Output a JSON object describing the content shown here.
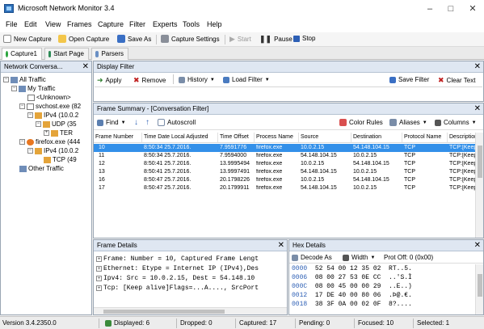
{
  "window": {
    "title": "Microsoft Network Monitor 3.4"
  },
  "menu": [
    "File",
    "Edit",
    "View",
    "Frames",
    "Capture",
    "Filter",
    "Experts",
    "Tools",
    "Help"
  ],
  "toolbar": {
    "new_capture": "New Capture",
    "open_capture": "Open Capture",
    "save_as": "Save As",
    "capture_settings": "Capture Settings",
    "start": "Start",
    "pause": "Pause",
    "stop": "Stop"
  },
  "tabs": [
    "Capture1",
    "Start Page",
    "Parsers"
  ],
  "conversations": {
    "header": "Network Conversa...",
    "items": [
      "All Traffic",
      "My Traffic",
      "<Unknown>",
      "svchost.exe (82",
      "IPv4 (10.0.2",
      "UDP (35",
      "TER",
      "firefox.exe (444",
      "IPv4 (10.0.2",
      "TCP (49",
      "Other Traffic"
    ]
  },
  "display_filter": {
    "header": "Display Filter",
    "apply": "Apply",
    "remove": "Remove",
    "history": "History",
    "load_filter": "Load Filter",
    "save_filter": "Save Filter",
    "clear_text": "Clear Text"
  },
  "frame_summary": {
    "header": "Frame Summary - [Conversation Filter]",
    "find": "Find",
    "autoscroll": "Autoscroll",
    "color_rules": "Color Rules",
    "aliases": "Aliases",
    "columns_btn": "Columns",
    "columns": [
      "Frame Number",
      "Time Date Local Adjusted",
      "Time Offset",
      "Process Name",
      "Source",
      "Destination",
      "Protocol Name",
      "Description"
    ],
    "rows": [
      [
        "10",
        "8:50:34 25.7.2016.",
        "7.9591776",
        "firefox.exe",
        "10.0.2.15",
        "54.148.104.15",
        "TCP",
        "TCP:[Keep a"
      ],
      [
        "11",
        "8:50:34 25.7.2016.",
        "7.9594000",
        "firefox.exe",
        "54.148.104.15",
        "10.0.2.15",
        "TCP",
        "TCP:[Keep a"
      ],
      [
        "12",
        "8:50:41 25.7.2016.",
        "13.9995494",
        "firefox.exe",
        "10.0.2.15",
        "54.148.104.15",
        "TCP",
        "TCP:[Keep a"
      ],
      [
        "13",
        "8:50:41 25.7.2016.",
        "13.9997491",
        "firefox.exe",
        "54.148.104.15",
        "10.0.2.15",
        "TCP",
        "TCP:[Keep a"
      ],
      [
        "16",
        "8:50:47 25.7.2016.",
        "20.1798226",
        "firefox.exe",
        "10.0.2.15",
        "54.148.104.15",
        "TCP",
        "TCP:[Keep a"
      ],
      [
        "17",
        "8:50:47 25.7.2016.",
        "20.1799911",
        "firefox.exe",
        "54.148.104.15",
        "10.0.2.15",
        "TCP",
        "TCP:[Keep a"
      ]
    ]
  },
  "frame_details": {
    "header": "Frame Details",
    "lines": [
      "Frame: Number = 10, Captured Frame Lengt",
      "Ethernet: Etype = Internet IP (IPv4),Des",
      "Ipv4: Src = 10.0.2.15, Dest = 54.148.10",
      "Tcp: [Keep alive]Flags=...A...., SrcPort"
    ]
  },
  "hex_details": {
    "header": "Hex Details",
    "decode_as": "Decode As",
    "width": "Width",
    "prot_off": "Prot Off: 0 (0x00)",
    "rows": [
      [
        "0000",
        "52 54 00 12 35 02",
        "RT..5."
      ],
      [
        "0006",
        "08 00 27 53 0E CC",
        "..'S.Ì"
      ],
      [
        "000C",
        "08 00 45 00 00 29",
        "..E..)"
      ],
      [
        "0012",
        "17 DE 40 00 80 06",
        ".Þ@.€."
      ],
      [
        "0018",
        "38 3F 0A 00 02 0F",
        "8?...."
      ]
    ]
  },
  "status": {
    "version": "Version 3.4.2350.0",
    "displayed": "Displayed: 6",
    "dropped": "Dropped: 0",
    "captured": "Captured: 17",
    "pending": "Pending: 0",
    "focused": "Focused: 10",
    "selected": "Selected: 1"
  },
  "colors": {
    "selection": "#3390e9",
    "pane_header": "#dfe7f2",
    "accent": "#2d6fb8"
  }
}
